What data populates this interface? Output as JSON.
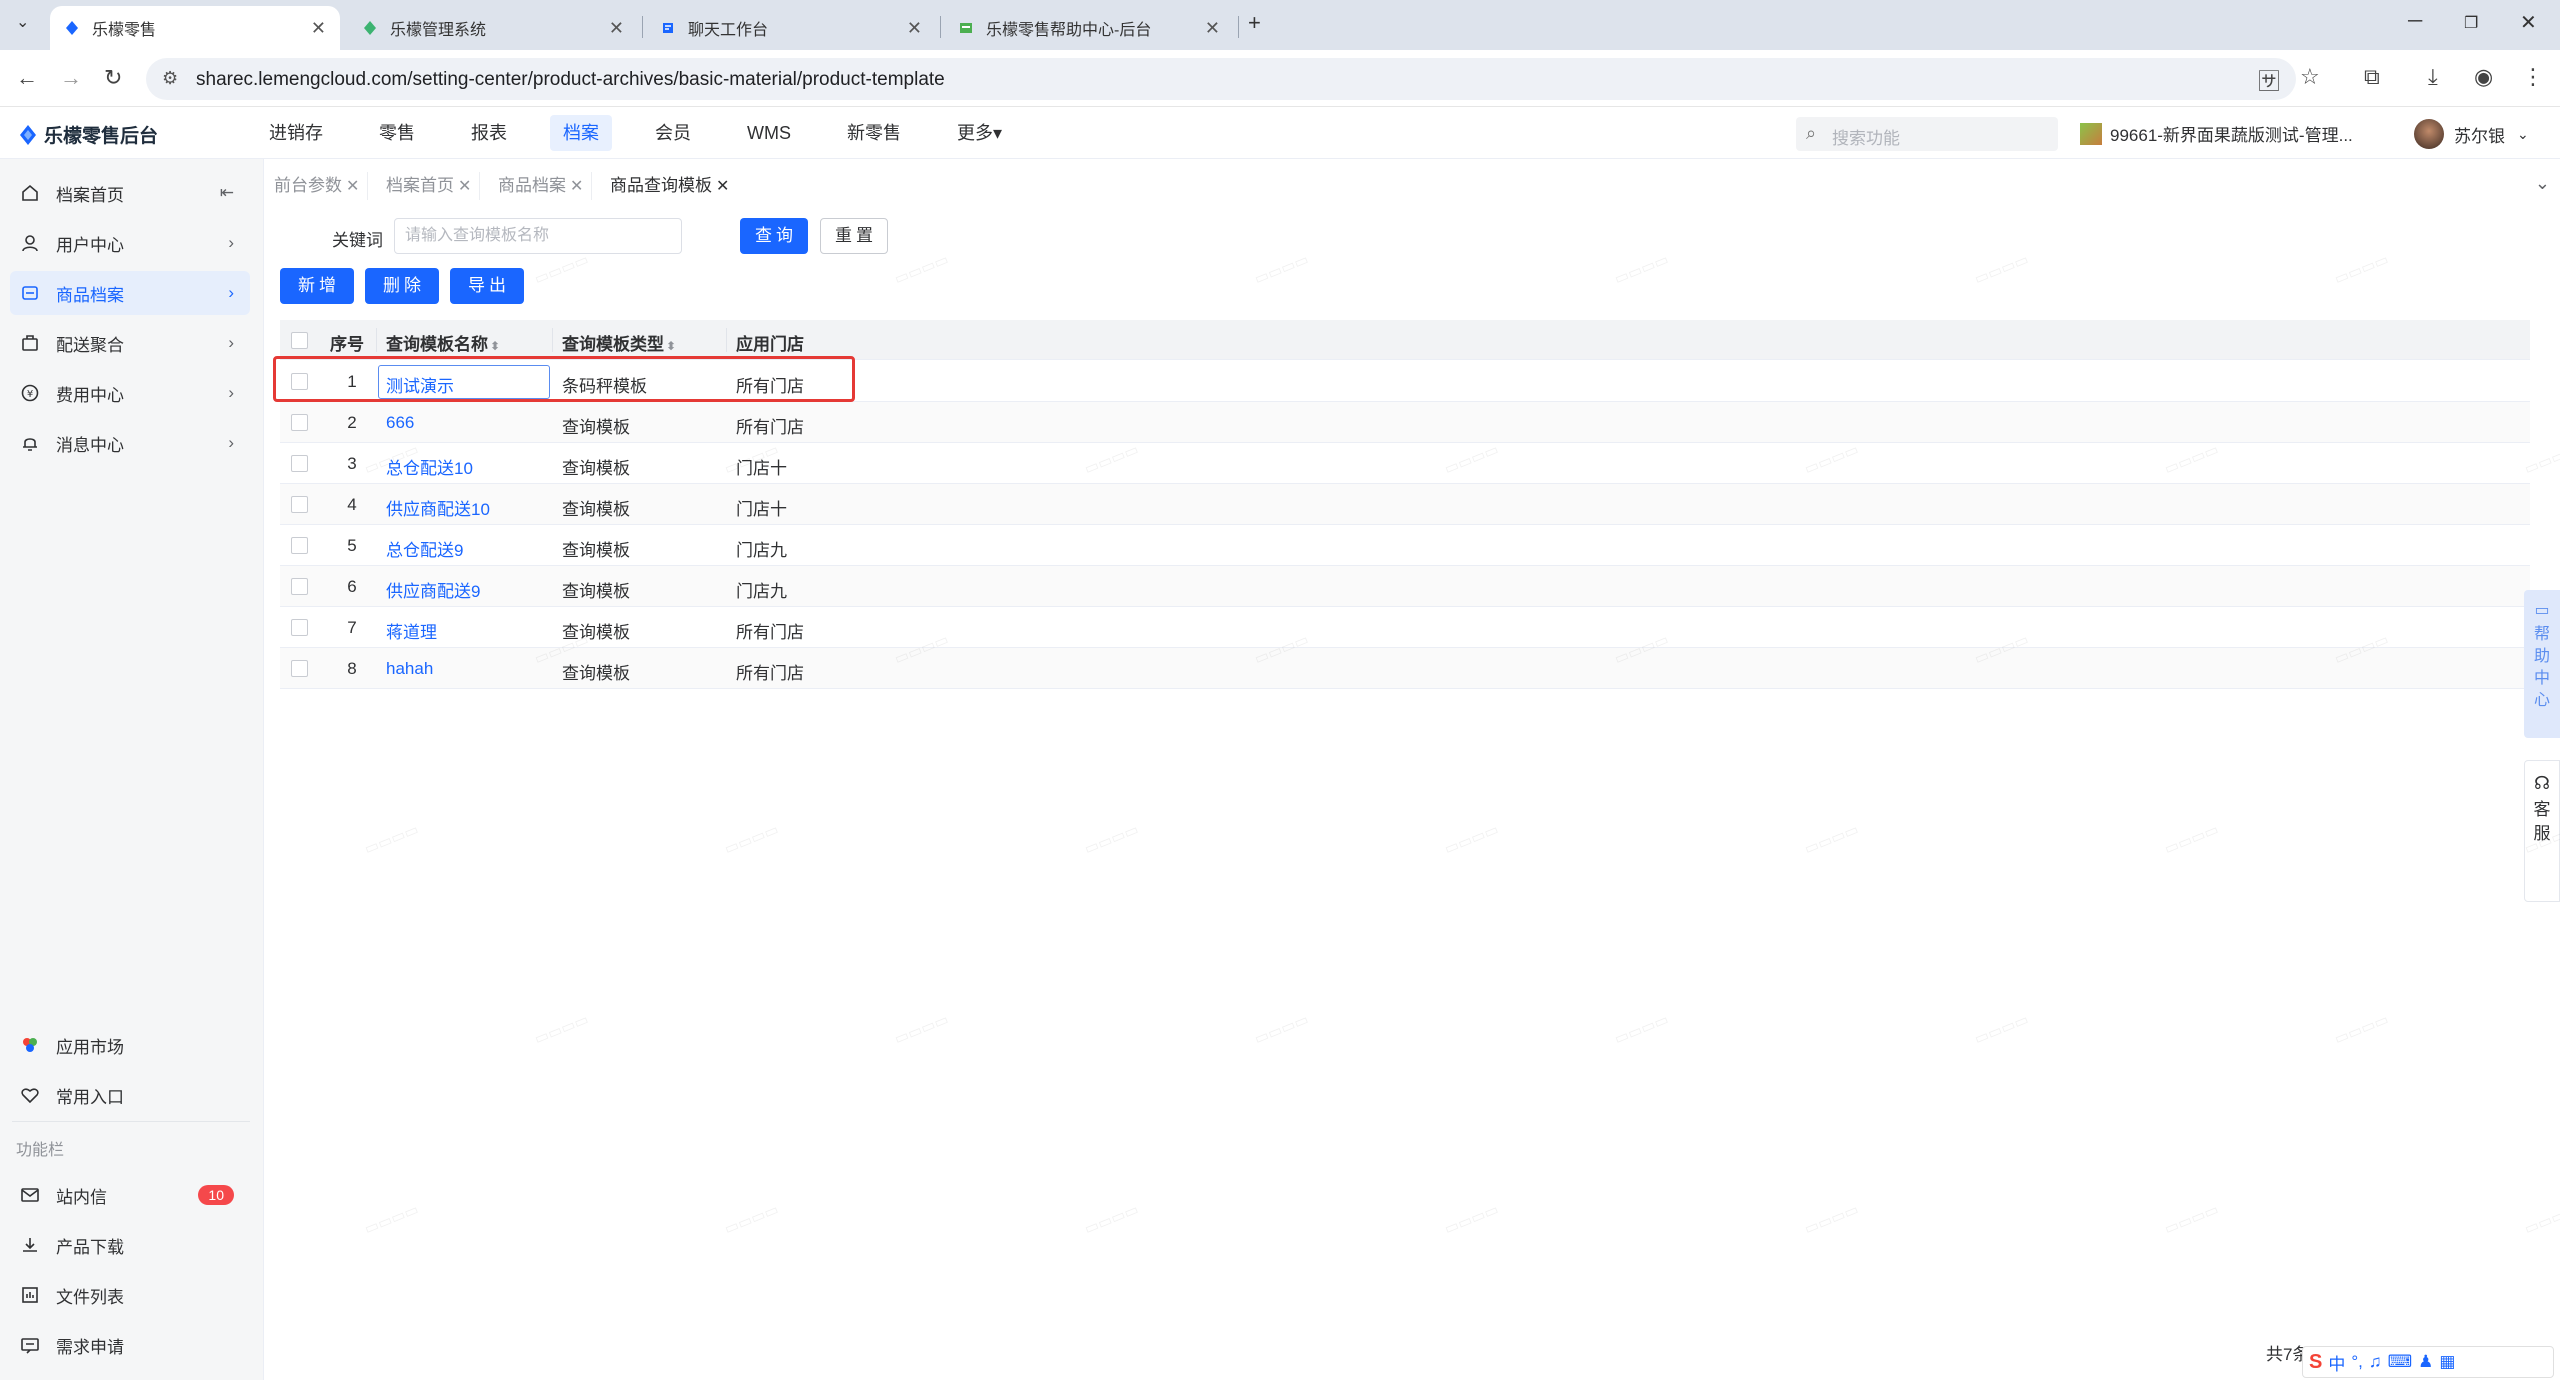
{
  "browser": {
    "tabs": [
      {
        "title": "乐檬零售",
        "active": true
      },
      {
        "title": "乐檬管理系统",
        "active": false
      },
      {
        "title": "聊天工作台",
        "active": false
      },
      {
        "title": "乐檬零售帮助中心-后台",
        "active": false
      }
    ],
    "url": "sharec.lemengcloud.com/setting-center/product-archives/basic-material/product-template"
  },
  "app": {
    "brand": "乐檬零售后台",
    "topnav": [
      {
        "label": "进销存",
        "active": false
      },
      {
        "label": "零售",
        "active": false
      },
      {
        "label": "报表",
        "active": false
      },
      {
        "label": "档案",
        "active": true
      },
      {
        "label": "会员",
        "active": false
      },
      {
        "label": "WMS",
        "active": false
      },
      {
        "label": "新零售",
        "active": false
      },
      {
        "label": "更多▾",
        "active": false
      }
    ],
    "search_placeholder": "搜索功能",
    "store": "99661-新界面果蔬版测试-管理...",
    "user": "苏尔银"
  },
  "sidebar": {
    "items": [
      {
        "label": "档案首页",
        "icon": "home-icon",
        "active": false
      },
      {
        "label": "用户中心",
        "icon": "user-icon",
        "active": false
      },
      {
        "label": "商品档案",
        "icon": "product-icon",
        "active": true
      },
      {
        "label": "配送聚合",
        "icon": "delivery-icon",
        "active": false
      },
      {
        "label": "费用中心",
        "icon": "fee-icon",
        "active": false
      },
      {
        "label": "消息中心",
        "icon": "bell-icon",
        "active": false
      }
    ],
    "bottom": [
      {
        "label": "应用市场",
        "icon": "app-market-icon"
      },
      {
        "label": "常用入口",
        "icon": "heart-icon"
      }
    ],
    "section_title": "功能栏",
    "func_items": [
      {
        "label": "站内信",
        "icon": "mail-icon",
        "badge": "10"
      },
      {
        "label": "产品下载",
        "icon": "download-icon"
      },
      {
        "label": "文件列表",
        "icon": "file-list-icon"
      },
      {
        "label": "需求申请",
        "icon": "request-icon"
      }
    ]
  },
  "tags": [
    {
      "label": "前台参数",
      "active": false
    },
    {
      "label": "档案首页",
      "active": false
    },
    {
      "label": "商品档案",
      "active": false
    },
    {
      "label": "商品查询模板",
      "active": true
    }
  ],
  "filter": {
    "keyword_label": "关键词",
    "keyword_placeholder": "请输入查询模板名称",
    "query_btn": "查询",
    "reset_btn": "重置"
  },
  "actions": {
    "add": "新增",
    "delete": "删除",
    "export": "导出"
  },
  "table": {
    "headers": {
      "index": "序号",
      "name": "查询模板名称",
      "type": "查询模板类型",
      "store": "应用门店"
    },
    "rows": [
      {
        "index": "1",
        "name": "测试演示",
        "type": "条码秤模板",
        "store": "所有门店"
      },
      {
        "index": "2",
        "name": "666",
        "type": "查询模板",
        "store": "所有门店"
      },
      {
        "index": "3",
        "name": "总仓配送10",
        "type": "查询模板",
        "store": "门店十"
      },
      {
        "index": "4",
        "name": "供应商配送10",
        "type": "查询模板",
        "store": "门店十"
      },
      {
        "index": "5",
        "name": "总仓配送9",
        "type": "查询模板",
        "store": "门店九"
      },
      {
        "index": "6",
        "name": "供应商配送9",
        "type": "查询模板",
        "store": "门店九"
      },
      {
        "index": "7",
        "name": "蒋道理",
        "type": "查询模板",
        "store": "所有门店"
      },
      {
        "index": "8",
        "name": "hahah",
        "type": "查询模板",
        "store": "所有门店"
      }
    ]
  },
  "side_float": {
    "help": [
      "帮",
      "助",
      "中",
      "心"
    ],
    "service": [
      "客",
      "服"
    ]
  },
  "pager_text": "共7条",
  "ime": {
    "lang": "中"
  },
  "colors": {
    "primary": "#1a66ff",
    "highlight": "#e53935",
    "badge": "#f5484b"
  }
}
